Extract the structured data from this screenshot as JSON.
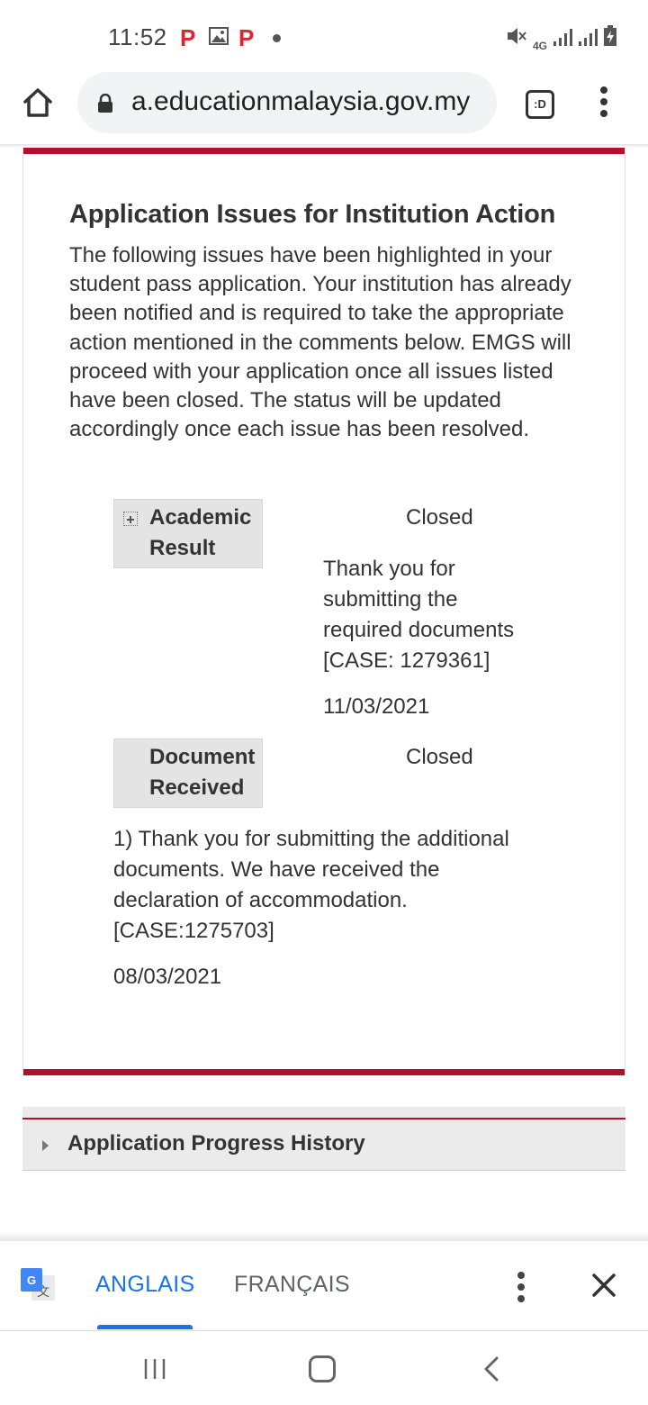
{
  "status_bar": {
    "time": "11:52",
    "network": "4G",
    "icons": [
      "pinterest-icon",
      "gallery-icon",
      "pinterest-icon",
      "notification-dot-icon",
      "mute-icon",
      "signal-icon",
      "signal-icon",
      "battery-charging-icon"
    ]
  },
  "browser": {
    "url": "a.educationmalaysia.gov.my",
    "tab_label": ":D"
  },
  "issues": {
    "title": "Application Issues for Institution Action",
    "description": "The following issues have been highlighted in your student pass application. Your institution has already been notified and is required to take the appropriate action mentioned in the comments below. EMGS will proceed with your application once all issues listed have been closed. The status will be updated accordingly once each issue has been resolved.",
    "items": [
      {
        "label_line1": "Academic",
        "label_line2": "Result",
        "status": "Closed",
        "comment_lines": [
          "Thank you for",
          "submitting the",
          "required documents",
          "[CASE: 1279361]"
        ],
        "date": "11/03/2021"
      },
      {
        "label_line1": "Document",
        "label_line2": "Received",
        "status": "Closed",
        "comment_lines": [
          "1) Thank you for submitting the additional",
          "documents. We have received the",
          "declaration of accommodation.",
          "[CASE:1275703]"
        ],
        "date": "08/03/2021"
      }
    ]
  },
  "history": {
    "label": "Application Progress History"
  },
  "translate": {
    "source_lang": "ANGLAIS",
    "target_lang": "FRANÇAIS"
  },
  "colors": {
    "accent_red": "#b30f2e",
    "translate_blue": "#1a73e8"
  }
}
